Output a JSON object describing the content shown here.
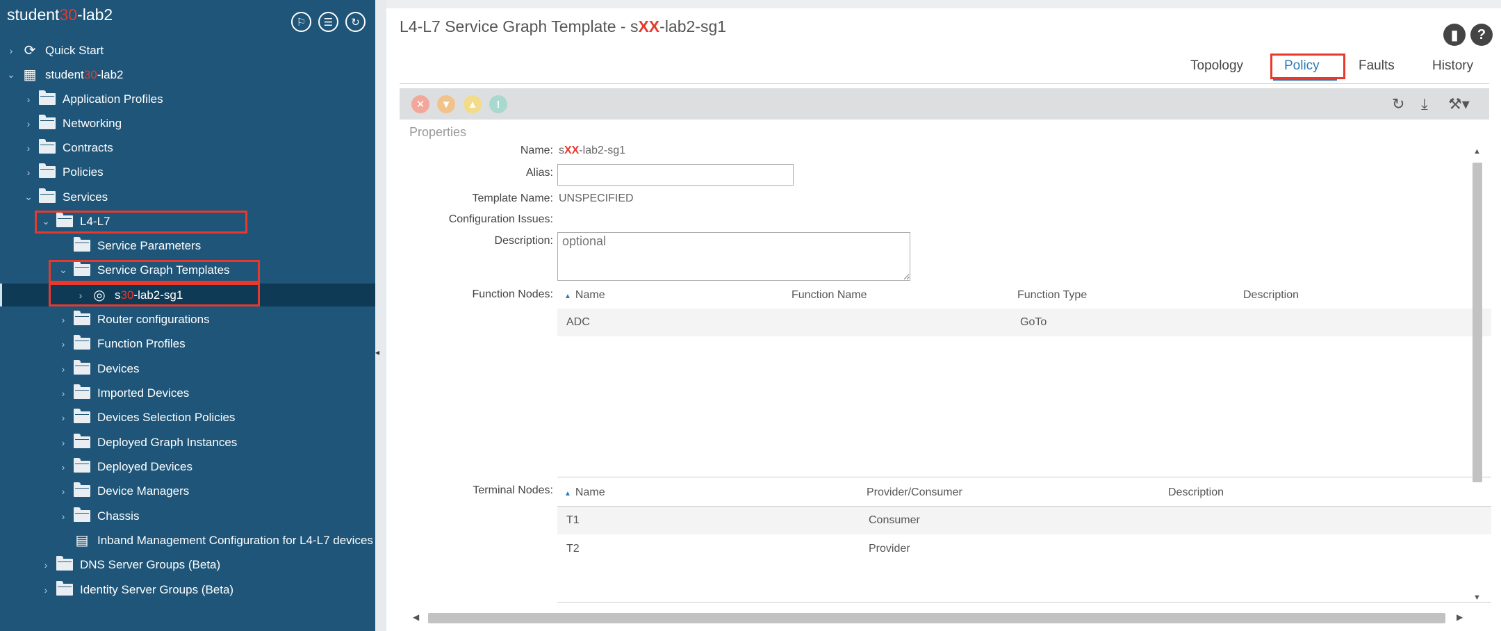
{
  "sidebar": {
    "title_prefix": "student",
    "title_redacted": "30",
    "title_suffix": "-lab2",
    "header_icons": [
      "pin-icon",
      "list-icon",
      "refresh-icon"
    ],
    "items": [
      {
        "label": "Quick Start"
      },
      {
        "label_prefix": "student",
        "label_redacted": "30",
        "label_suffix": "-lab2"
      },
      {
        "label": "Application Profiles"
      },
      {
        "label": "Networking"
      },
      {
        "label": "Contracts"
      },
      {
        "label": "Policies"
      },
      {
        "label": "Services"
      },
      {
        "label": "L4-L7"
      },
      {
        "label": "Service Parameters"
      },
      {
        "label": "Service Graph Templates"
      },
      {
        "label_prefix": "s",
        "label_redacted": "30",
        "label_suffix": "-lab2-sg1"
      },
      {
        "label": "Router configurations"
      },
      {
        "label": "Function Profiles"
      },
      {
        "label": "Devices"
      },
      {
        "label": "Imported Devices"
      },
      {
        "label": "Devices Selection Policies"
      },
      {
        "label": "Deployed Graph Instances"
      },
      {
        "label": "Deployed Devices"
      },
      {
        "label": "Device Managers"
      },
      {
        "label": "Chassis"
      },
      {
        "label": "Inband Management Configuration for L4-L7 devices"
      },
      {
        "label": "DNS Server Groups (Beta)"
      },
      {
        "label": "Identity Server Groups (Beta)"
      }
    ]
  },
  "header": {
    "title_prefix": "L4-L7 Service Graph Template - s",
    "title_redacted": "XX",
    "title_suffix": "-lab2-sg1",
    "icons": [
      "bookmark-icon",
      "help-icon"
    ]
  },
  "tabs": [
    {
      "label": "Topology"
    },
    {
      "label": "Policy",
      "active": true
    },
    {
      "label": "Faults"
    },
    {
      "label": "History"
    }
  ],
  "toolbar": {
    "fault_icons": [
      {
        "name": "critical-fault-icon",
        "color": "#f2a79b"
      },
      {
        "name": "major-fault-icon",
        "color": "#f1c38a"
      },
      {
        "name": "minor-fault-icon",
        "color": "#f2dc8a"
      },
      {
        "name": "warning-fault-icon",
        "color": "#a9d8cf"
      }
    ],
    "right_icons": [
      "refresh-icon",
      "download-icon",
      "tools-icon"
    ]
  },
  "properties": {
    "section_label": "Properties",
    "name_label": "Name:",
    "name_prefix": "s",
    "name_redacted": "XX",
    "name_suffix": "-lab2-sg1",
    "alias_label": "Alias:",
    "alias_value": "",
    "template_name_label": "Template Name:",
    "template_name_value": "UNSPECIFIED",
    "config_issues_label": "Configuration Issues:",
    "description_label": "Description:",
    "description_placeholder": "optional",
    "function_nodes_label": "Function Nodes:",
    "function_nodes": {
      "columns": [
        "Name",
        "Function Name",
        "Function Type",
        "Description"
      ],
      "rows": [
        {
          "name": "ADC",
          "function_name": "",
          "function_type": "GoTo",
          "description": ""
        }
      ]
    },
    "terminal_nodes_label": "Terminal Nodes:",
    "terminal_nodes": {
      "columns": [
        "Name",
        "Provider/Consumer",
        "Description"
      ],
      "rows": [
        {
          "name": "T1",
          "provider_consumer": "Consumer",
          "description": ""
        },
        {
          "name": "T2",
          "provider_consumer": "Provider",
          "description": ""
        }
      ]
    }
  },
  "colors": {
    "sidebar_bg": "#1e5578",
    "accent": "#2a7ab5",
    "highlight": "#e8392c"
  }
}
